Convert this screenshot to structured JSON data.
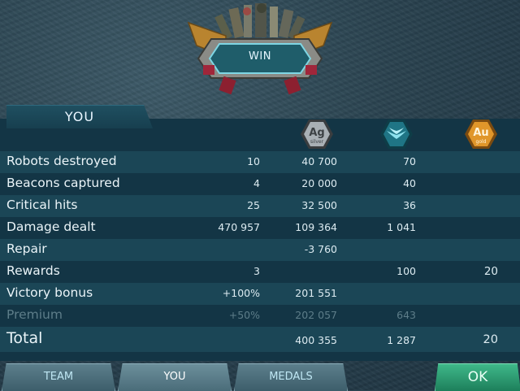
{
  "result_label": "WIN",
  "tab_you": "YOU",
  "currencies": {
    "silver": {
      "symbol": "Ag",
      "sub": "silver",
      "color": "#9aa1a6"
    },
    "xp": {
      "icon": "wings-icon",
      "color": "#1d6f7e"
    },
    "gold": {
      "symbol": "Au",
      "sub": "gold",
      "color": "#d9901f"
    }
  },
  "rows": [
    {
      "label": "Robots destroyed",
      "count": "10",
      "silver": "40 700",
      "xp": "70",
      "gold": ""
    },
    {
      "label": "Beacons captured",
      "count": "4",
      "silver": "20 000",
      "xp": "40",
      "gold": ""
    },
    {
      "label": "Critical hits",
      "count": "25",
      "silver": "32 500",
      "xp": "36",
      "gold": ""
    },
    {
      "label": "Damage dealt",
      "count": "470 957",
      "silver": "109 364",
      "xp": "1 041",
      "gold": ""
    },
    {
      "label": "Repair",
      "count": "",
      "silver": "-3 760",
      "xp": "",
      "gold": ""
    },
    {
      "label": "Rewards",
      "count": "3",
      "silver": "",
      "xp": "100",
      "gold": "20"
    },
    {
      "label": "Victory bonus",
      "count": "+100%",
      "silver": "201 551",
      "xp": "",
      "gold": ""
    },
    {
      "label": "Premium",
      "count": "+50%",
      "silver": "202 057",
      "xp": "643",
      "gold": ""
    },
    {
      "label": "Total",
      "count": "",
      "silver": "400 355",
      "xp": "1 287",
      "gold": "20"
    }
  ],
  "buttons": {
    "team": "TEAM",
    "you": "YOU",
    "medals": "MEDALS",
    "ok": "OK"
  }
}
